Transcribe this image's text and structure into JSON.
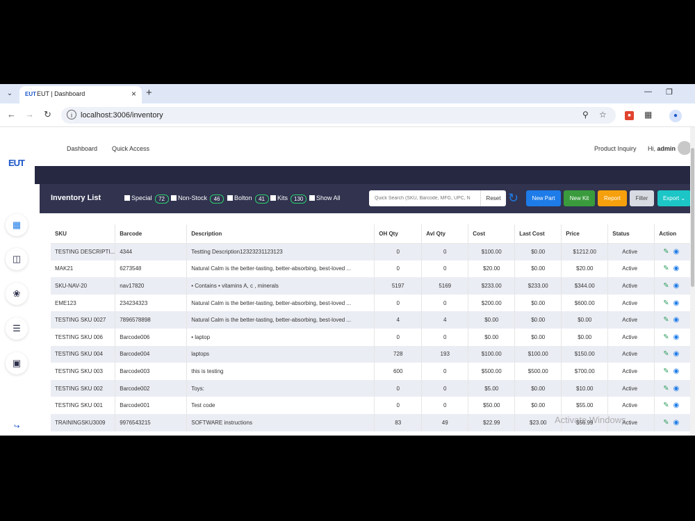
{
  "browser": {
    "tab_title": "EUT | Dashboard",
    "favicon_text": "EUT",
    "url": "localhost:3006/inventory"
  },
  "app": {
    "logo": "EUT",
    "nav": {
      "dashboard": "Dashboard",
      "quick_access": "Quick Access",
      "product_inquiry": "Product Inquiry"
    },
    "greeting_prefix": "Hi,",
    "user": "admin"
  },
  "toolbar": {
    "title": "Inventory List",
    "filters": [
      {
        "label": "Special",
        "count": "72"
      },
      {
        "label": "Non-Stock",
        "count": "46"
      },
      {
        "label": "Bolton",
        "count": "41"
      },
      {
        "label": "Kits",
        "count": "130"
      },
      {
        "label": "Show All"
      }
    ],
    "search_placeholder": "Quick Search (SKU, Barcode, MFG, UPC, N",
    "reset_label": "Reset",
    "buttons": {
      "new_part": "New Part",
      "new_kit": "New Kit",
      "report": "Report",
      "filter": "Filter",
      "export": "Export"
    },
    "colors": {
      "new_part": "#1e7ce8",
      "new_kit": "#3a9b3d",
      "report": "#f5a00c",
      "filter": "#d8dbe2",
      "export": "#1cc6c6"
    }
  },
  "table": {
    "headers": [
      "SKU",
      "Barcode",
      "Description",
      "OH Qty",
      "Avl Qty",
      "Cost",
      "Last Cost",
      "Price",
      "Status",
      "Action"
    ],
    "rows": [
      [
        "TESTING DESCRIPTI...",
        "4344",
        "Testting Description12323231123123",
        "0",
        "0",
        "$100.00",
        "$0.00",
        "$1212.00",
        "Active"
      ],
      [
        "MAK21",
        "6273548",
        "Natural Calm is the better-tasting, better-absorbing, best-loved ...",
        "0",
        "0",
        "$20.00",
        "$0.00",
        "$20.00",
        "Active"
      ],
      [
        "SKU-NAV-20",
        "nav17820",
        "• Contains • vitamins A, c , minerals",
        "5197",
        "5169",
        "$233.00",
        "$233.00",
        "$344.00",
        "Active"
      ],
      [
        "EME123",
        "234234323",
        "Natural Calm is the better-tasting, better-absorbing, best-loved ...",
        "0",
        "0",
        "$200.00",
        "$0.00",
        "$600.00",
        "Active"
      ],
      [
        "TESTING SKU 0027",
        "7896578898",
        "Natural Calm is the better-tasting, better-absorbing, best-loved ...",
        "4",
        "4",
        "$0.00",
        "$0.00",
        "$0.00",
        "Active"
      ],
      [
        "TESTING SKU 006",
        "Barcode006",
        "• laptop",
        "0",
        "0",
        "$0.00",
        "$0.00",
        "$0.00",
        "Active"
      ],
      [
        "TESTING SKU 004",
        "Barcode004",
        "laptops",
        "728",
        "193",
        "$100.00",
        "$100.00",
        "$150.00",
        "Active"
      ],
      [
        "TESTING SKU 003",
        "Barcode003",
        "this is testing",
        "600",
        "0",
        "$500.00",
        "$500.00",
        "$700.00",
        "Active"
      ],
      [
        "TESTING SKU 002",
        "Barcode002",
        "Toys:",
        "0",
        "0",
        "$5.00",
        "$0.00",
        "$10.00",
        "Active"
      ],
      [
        "TESTING SKU 001",
        "Barcode001",
        "Test code",
        "0",
        "0",
        "$50.00",
        "$0.00",
        "$55.00",
        "Active"
      ],
      [
        "TRAININGSKU3009",
        "9976543215",
        "SOFTWARE instructions",
        "83",
        "49",
        "$22.99",
        "$23.00",
        "$56.99",
        "Active"
      ]
    ]
  },
  "watermark": "Activate Windows"
}
